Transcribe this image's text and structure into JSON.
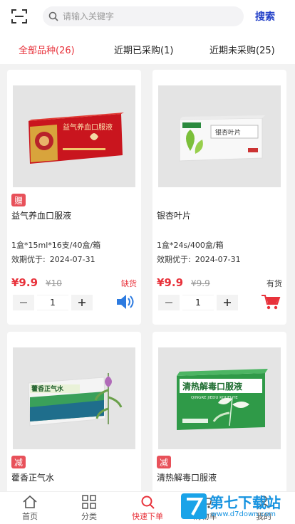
{
  "header": {
    "scan_icon": "scan-icon",
    "search_icon": "search-icon",
    "search_placeholder": "请输入关键字",
    "search_button": "搜索"
  },
  "tabs": [
    {
      "label": "全部品种(26)",
      "active": true
    },
    {
      "label": "近期已采购(1)",
      "active": false
    },
    {
      "label": "近期未采购(25)",
      "active": false
    }
  ],
  "colors": {
    "accent_red": "#e8323b",
    "search_blue": "#2340c8",
    "badge_red": "#e8515a",
    "speaker_blue": "#2d7be0",
    "cart_red": "#e8323b"
  },
  "products": [
    {
      "badge": "赠",
      "name": "益气养血口服液",
      "spec": "1盒*15ml*16支/40盒/箱",
      "expiry_label": "效期优于:",
      "expiry_value": "2024-07-31",
      "price": "¥9.9",
      "original_price": "¥10",
      "stock": "缺货",
      "quantity": "1",
      "action_icon": "speaker-icon",
      "box_text": "益气养血口服液"
    },
    {
      "badge": "",
      "name": "银杏叶片",
      "spec": "1盒*24s/400盒/箱",
      "expiry_label": "效期优于:",
      "expiry_value": "2024-07-31",
      "price": "¥9.9",
      "original_price": "¥9.9",
      "stock": "有货",
      "quantity": "1",
      "action_icon": "cart-icon",
      "box_text": "银杏叶片"
    },
    {
      "badge": "减",
      "name": "藿香正气水",
      "box_text": "藿香正气水"
    },
    {
      "badge": "减",
      "name": "清热解毒口服液",
      "box_text": "清热解毒口服液",
      "box_subtext": "QINGRE JIEDU KOUFUYE"
    }
  ],
  "bottom_nav": [
    {
      "label": "首页",
      "icon": "home-icon",
      "active": false
    },
    {
      "label": "分类",
      "icon": "grid-icon",
      "active": false
    },
    {
      "label": "快速下单",
      "icon": "search-icon",
      "active": true
    },
    {
      "label": "购物车",
      "icon": "cart-icon",
      "active": false
    },
    {
      "label": "我的",
      "icon": "user-icon",
      "active": false
    }
  ],
  "watermark": {
    "title": "第七下载站",
    "url": "www.d7down.com"
  }
}
